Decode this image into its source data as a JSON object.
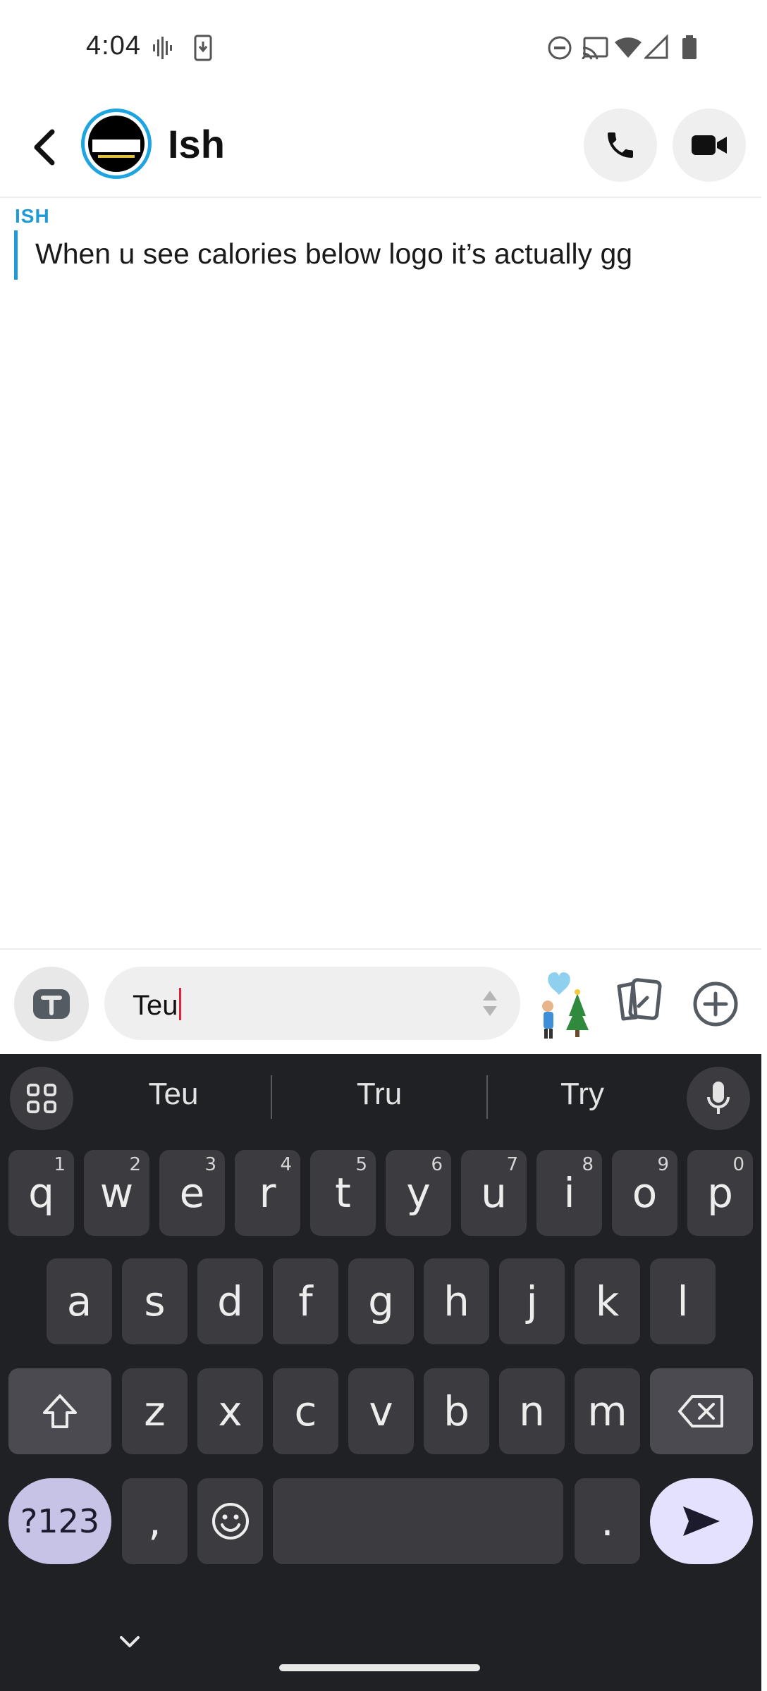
{
  "status_bar": {
    "time": "4:04",
    "icons": [
      "voicemail-icon",
      "download-icon",
      "do-not-disturb-icon",
      "cast-icon",
      "wifi-icon",
      "signal-icon",
      "battery-icon"
    ]
  },
  "header": {
    "contact_name": "Ish",
    "icons": [
      "back-arrow-icon",
      "phone-icon",
      "video-camera-icon"
    ]
  },
  "chat": {
    "messages": [
      {
        "sender": "ISH",
        "text": "When u see calories below logo it’s actually gg"
      }
    ]
  },
  "composer": {
    "input_value": "Teu",
    "icons": [
      "camera-icon",
      "expand-icon",
      "sticker-icon",
      "memories-icon",
      "plus-icon"
    ]
  },
  "keyboard": {
    "suggestions": [
      "Teu",
      "Tru",
      "Try"
    ],
    "row1": [
      {
        "letter": "q",
        "hint": "1"
      },
      {
        "letter": "w",
        "hint": "2"
      },
      {
        "letter": "e",
        "hint": "3"
      },
      {
        "letter": "r",
        "hint": "4"
      },
      {
        "letter": "t",
        "hint": "5"
      },
      {
        "letter": "y",
        "hint": "6"
      },
      {
        "letter": "u",
        "hint": "7"
      },
      {
        "letter": "i",
        "hint": "8"
      },
      {
        "letter": "o",
        "hint": "9"
      },
      {
        "letter": "p",
        "hint": "0"
      }
    ],
    "row2": [
      "a",
      "s",
      "d",
      "f",
      "g",
      "h",
      "j",
      "k",
      "l"
    ],
    "row3": [
      "z",
      "x",
      "c",
      "v",
      "b",
      "n",
      "m"
    ],
    "symbols_label": "?123",
    "comma_label": ",",
    "period_label": "."
  },
  "colors": {
    "accent_blue": "#1e9ad6",
    "keyboard_bg": "#202124",
    "key_bg": "#3c3c40",
    "caret": "#e0223a"
  }
}
